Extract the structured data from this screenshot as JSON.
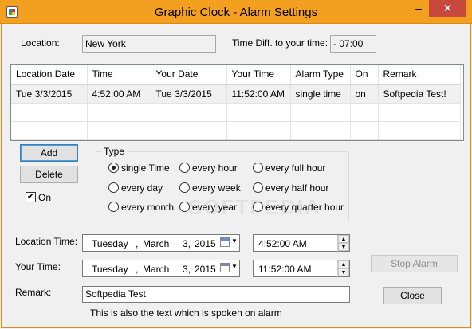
{
  "window": {
    "title": "Graphic Clock - Alarm Settings",
    "minimize": "–",
    "close": "✕",
    "accent": "#f3a021"
  },
  "location": {
    "label": "Location:",
    "value": "New York"
  },
  "timediff": {
    "label": "Time Diff. to your time:",
    "value": "- 07:00"
  },
  "grid": {
    "columns": [
      "Location Date",
      "Time",
      "Your Date",
      "Your Time",
      "Alarm Type",
      "On",
      "Remark"
    ],
    "rows": [
      [
        "Tue  3/3/2015",
        "4:52:00 AM",
        "Tue  3/3/2015",
        "11:52:00 AM",
        "single time",
        "on",
        "Softpedia Test!"
      ]
    ]
  },
  "buttons": {
    "add": "Add",
    "delete": "Delete",
    "stop_alarm": "Stop Alarm",
    "close": "Close"
  },
  "on_checkbox": {
    "label": "On",
    "checked": true
  },
  "type": {
    "legend": "Type",
    "options": [
      "single Time",
      "every hour",
      "every full hour",
      "every day",
      "every week",
      "every half hour",
      "every month",
      "every year",
      "every quarter hour"
    ],
    "selected": "single Time"
  },
  "location_time": {
    "label": "Location Time:",
    "weekday": "Tuesday",
    "month": "March",
    "day": "3,",
    "year": "2015",
    "time": "4:52:00 AM"
  },
  "your_time": {
    "label": "Your Time:",
    "weekday": "Tuesday",
    "month": "March",
    "day": "3,",
    "year": "2015",
    "time": "11:52:00 AM"
  },
  "remark": {
    "label": "Remark:",
    "value": "Softpedia Test!",
    "hint": "This is also the text which is spoken on alarm"
  },
  "watermark": "SOFTPEDIA"
}
